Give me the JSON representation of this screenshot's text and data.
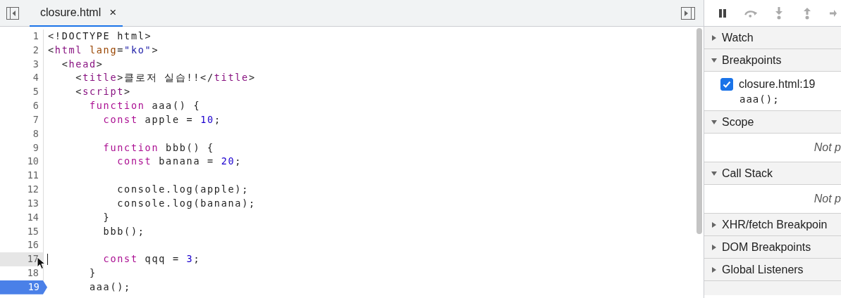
{
  "editor_tabs": [
    {
      "label": "closure.html",
      "close": "×",
      "selected": true
    }
  ],
  "code_lines": [
    {
      "number": "1",
      "breakpoint": false,
      "hovered": false,
      "tokens": [
        {
          "kind": "plain",
          "text": "<!DOCTYPE html>"
        }
      ]
    },
    {
      "number": "2",
      "breakpoint": false,
      "hovered": false,
      "tokens": [
        {
          "kind": "plain",
          "text": "<"
        },
        {
          "kind": "tag",
          "text": "html"
        },
        {
          "kind": "attr",
          "text": " lang"
        },
        {
          "kind": "plain",
          "text": "="
        },
        {
          "kind": "string",
          "text": "\"ko\""
        },
        {
          "kind": "plain",
          "text": ">"
        }
      ]
    },
    {
      "number": "3",
      "breakpoint": false,
      "hovered": false,
      "tokens": [
        {
          "kind": "plain",
          "text": "  <"
        },
        {
          "kind": "tag",
          "text": "head"
        },
        {
          "kind": "plain",
          "text": ">"
        }
      ]
    },
    {
      "number": "4",
      "breakpoint": false,
      "hovered": false,
      "tokens": [
        {
          "kind": "plain",
          "text": "    <"
        },
        {
          "kind": "tag",
          "text": "title"
        },
        {
          "kind": "plain",
          "text": ">클로저 실습!!</"
        },
        {
          "kind": "tag",
          "text": "title"
        },
        {
          "kind": "plain",
          "text": ">"
        }
      ]
    },
    {
      "number": "5",
      "breakpoint": false,
      "hovered": false,
      "tokens": [
        {
          "kind": "plain",
          "text": "    <"
        },
        {
          "kind": "tag",
          "text": "script"
        },
        {
          "kind": "plain",
          "text": ">"
        }
      ]
    },
    {
      "number": "6",
      "breakpoint": false,
      "hovered": false,
      "tokens": [
        {
          "kind": "keyword",
          "text": "      function"
        },
        {
          "kind": "plain",
          "text": " aaa() {"
        }
      ]
    },
    {
      "number": "7",
      "breakpoint": false,
      "hovered": false,
      "tokens": [
        {
          "kind": "keyword",
          "text": "        const"
        },
        {
          "kind": "plain",
          "text": " apple = "
        },
        {
          "kind": "number",
          "text": "10"
        },
        {
          "kind": "plain",
          "text": ";"
        }
      ]
    },
    {
      "number": "8",
      "breakpoint": false,
      "hovered": false
    },
    {
      "number": "9",
      "breakpoint": false,
      "hovered": false,
      "tokens": [
        {
          "kind": "keyword",
          "text": "        function"
        },
        {
          "kind": "plain",
          "text": " bbb() {"
        }
      ]
    },
    {
      "number": "10",
      "breakpoint": false,
      "hovered": false,
      "tokens": [
        {
          "kind": "keyword",
          "text": "          const"
        },
        {
          "kind": "plain",
          "text": " banana = "
        },
        {
          "kind": "number",
          "text": "20"
        },
        {
          "kind": "plain",
          "text": ";"
        }
      ]
    },
    {
      "number": "11",
      "breakpoint": false,
      "hovered": false
    },
    {
      "number": "12",
      "breakpoint": false,
      "hovered": false,
      "tokens": [
        {
          "kind": "plain",
          "text": "          console.log(apple);"
        }
      ]
    },
    {
      "number": "13",
      "breakpoint": false,
      "hovered": false,
      "tokens": [
        {
          "kind": "plain",
          "text": "          console.log(banana);"
        }
      ]
    },
    {
      "number": "14",
      "breakpoint": false,
      "hovered": false,
      "tokens": [
        {
          "kind": "plain",
          "text": "        }"
        }
      ]
    },
    {
      "number": "15",
      "breakpoint": false,
      "hovered": false,
      "tokens": [
        {
          "kind": "plain",
          "text": "        bbb();"
        }
      ]
    },
    {
      "number": "16",
      "breakpoint": false,
      "hovered": false
    },
    {
      "number": "17",
      "breakpoint": false,
      "hovered": true,
      "tokens": [
        {
          "kind": "keyword",
          "text": "        const"
        },
        {
          "kind": "plain",
          "text": " qqq = "
        },
        {
          "kind": "number",
          "text": "3"
        },
        {
          "kind": "plain",
          "text": ";"
        }
      ]
    },
    {
      "number": "18",
      "breakpoint": false,
      "hovered": false,
      "tokens": [
        {
          "kind": "plain",
          "text": "      }"
        }
      ]
    },
    {
      "number": "19",
      "breakpoint": true,
      "hovered": false,
      "tokens": [
        {
          "kind": "plain",
          "text": "      aaa();"
        }
      ]
    }
  ],
  "sections": [
    {
      "title": "Watch",
      "expanded": false
    },
    {
      "title": "Breakpoints",
      "expanded": true,
      "breakpoints": [
        {
          "location": "closure.html:19",
          "code": "aaa();",
          "checked": true
        }
      ]
    },
    {
      "title": "Scope",
      "expanded": true,
      "message": "Not p"
    },
    {
      "title": "Call Stack",
      "expanded": true,
      "message": "Not p"
    },
    {
      "title": "XHR/fetch Breakpoin",
      "expanded": false
    },
    {
      "title": "DOM Breakpoints",
      "expanded": false
    },
    {
      "title": "Global Listeners",
      "expanded": false
    }
  ]
}
